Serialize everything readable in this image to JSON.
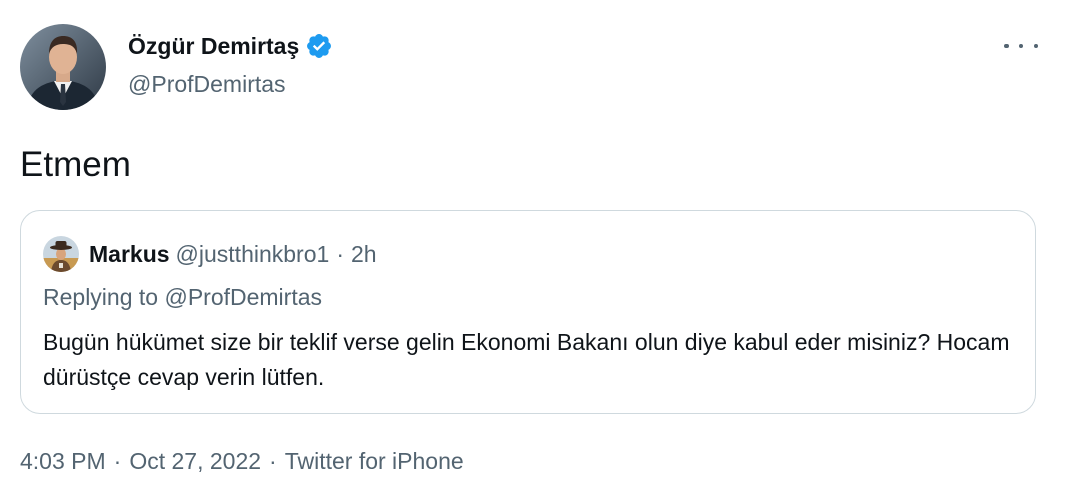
{
  "author": {
    "display_name": "Özgür Demirtaş",
    "handle": "@ProfDemirtas",
    "verified": true,
    "avatar_icon": "profile-photo-man-in-suit"
  },
  "more_icon": "ellipsis-horizontal-icon",
  "tweet": {
    "text": "Etmem"
  },
  "quoted_tweet": {
    "display_name": "Markus",
    "handle": "@justthinkbro1",
    "separator": "·",
    "time": "2h",
    "avatar_icon": "profile-photo-cowboy",
    "replying_prefix": "Replying to",
    "replying_handle": "@ProfDemirtas",
    "text": "Bugün hükümet size bir teklif verse gelin Ekonomi Bakanı olun diye kabul eder misiniz? Hocam dürüstçe cevap verin lütfen."
  },
  "meta": {
    "time": "4:03 PM",
    "separator": "·",
    "date": "Oct 27, 2022",
    "source": "Twitter for iPhone"
  },
  "colors": {
    "text_primary": "#0f1419",
    "text_secondary": "#536471",
    "border": "#cfd9de",
    "verified_blue": "#1d9bf0"
  }
}
